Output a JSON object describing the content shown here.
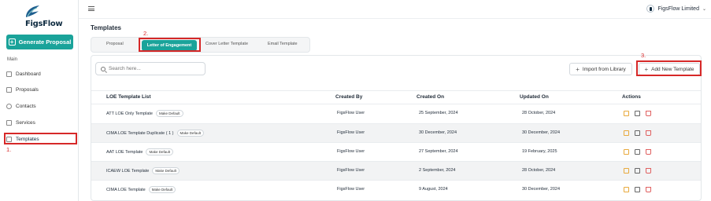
{
  "sidebar": {
    "logo_text": "FigsFlow",
    "generate_button": "Generate Proposal",
    "section_label": "Main",
    "items": [
      {
        "label": "Dashboard",
        "icon": "dashboard-icon"
      },
      {
        "label": "Proposals",
        "icon": "document-icon"
      },
      {
        "label": "Contacts",
        "icon": "contacts-icon"
      },
      {
        "label": "Services",
        "icon": "services-icon"
      },
      {
        "label": "Templates",
        "icon": "templates-icon"
      }
    ]
  },
  "header": {
    "org_name": "FigsFlow Limited"
  },
  "page": {
    "title": "Templates",
    "tabs": [
      {
        "label": "Proposal",
        "active": false
      },
      {
        "label": "Letter of Engagement",
        "active": true
      },
      {
        "label": "Cover Letter Template",
        "active": false
      },
      {
        "label": "Email Template",
        "active": false
      }
    ]
  },
  "toolbar": {
    "search_placeholder": "Search here...",
    "import_label": "Import from Library",
    "add_label": "Add New Template"
  },
  "annotations": {
    "step1": "1.",
    "step2": "2.",
    "step3": "3."
  },
  "table": {
    "columns": [
      "LOE Template List",
      "Created By",
      "Created On",
      "Updated On",
      "Actions"
    ],
    "badge_label": "Make Default",
    "rows": [
      {
        "name": "ATT LOE Only Template",
        "created_by": "FigsFlow User",
        "created_on": "25 September, 2024",
        "updated_on": "28 October, 2024"
      },
      {
        "name": "CIMA LOE Template Duplicate ( 1 )",
        "created_by": "FigsFlow User",
        "created_on": "30 December, 2024",
        "updated_on": "30 December, 2024"
      },
      {
        "name": "AAT LOE Template",
        "created_by": "FigsFlow User",
        "created_on": "27 September, 2024",
        "updated_on": "19 February, 2025"
      },
      {
        "name": "ICAEW LOE Template",
        "created_by": "FigsFlow User",
        "created_on": "2 September, 2024",
        "updated_on": "28 October, 2024"
      },
      {
        "name": "CIMA LOE Template",
        "created_by": "FigsFlow User",
        "created_on": "9 August, 2024",
        "updated_on": "30 December, 2024"
      }
    ]
  },
  "colors": {
    "accent": "#1aa39a",
    "annotation": "#d62828",
    "edit_icon": "#e8a93c",
    "delete_icon": "#e06060"
  }
}
